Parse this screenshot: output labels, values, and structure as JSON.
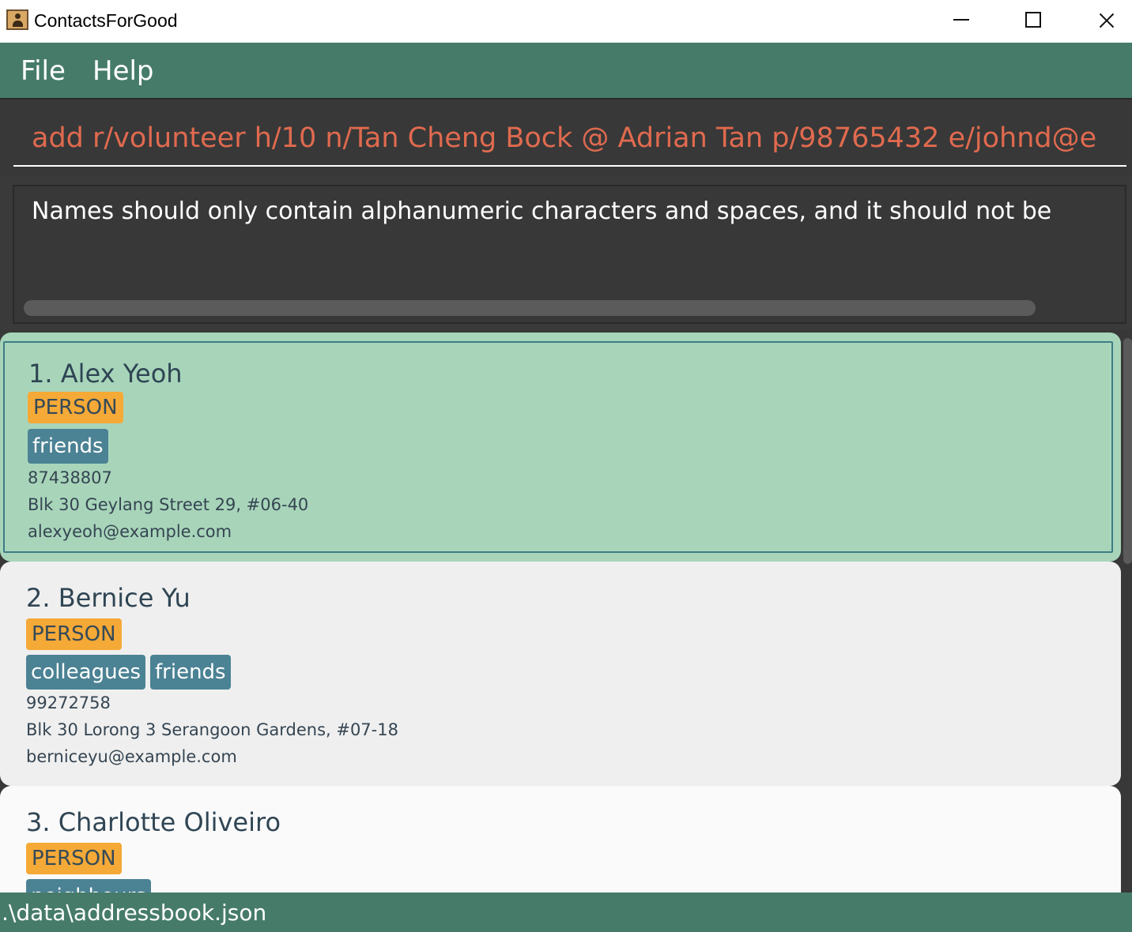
{
  "window": {
    "title": "ContactsForGood",
    "icon": "contacts-book-icon"
  },
  "menu": {
    "items": [
      {
        "label": "File"
      },
      {
        "label": "Help"
      }
    ]
  },
  "command": {
    "value": "add r/volunteer h/10 n/Tan Cheng Bock @ Adrian Tan p/98765432 e/johnd@e"
  },
  "result": {
    "message": "Names should only contain alphanumeric characters and spaces, and it should not be"
  },
  "persons": [
    {
      "name": "1. Alex Yeoh",
      "type": "PERSON",
      "tags": [
        "friends"
      ],
      "phone": "87438807",
      "address": "Blk 30 Geylang Street 29, #06-40",
      "email": "alexyeoh@example.com",
      "selected": true
    },
    {
      "name": "2. Bernice Yu",
      "type": "PERSON",
      "tags": [
        "colleagues",
        "friends"
      ],
      "phone": "99272758",
      "address": "Blk 30 Lorong 3 Serangoon Gardens, #07-18",
      "email": "berniceyu@example.com",
      "selected": false
    },
    {
      "name": "3. Charlotte Oliveiro",
      "type": "PERSON",
      "tags": [
        "neighbours"
      ],
      "selected": false
    }
  ],
  "status": {
    "file_path": ".\\data\\addressbook.json"
  },
  "colors": {
    "menu_bar": "#467b6a",
    "command_text": "#e06a4f",
    "selected_card": "#a8d5ba",
    "person_badge": "#f5a937",
    "tag": "#4b8294"
  }
}
